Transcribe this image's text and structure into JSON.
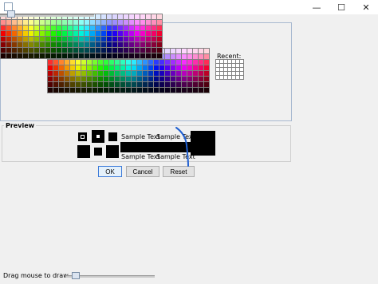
{
  "window": {
    "title": "",
    "minimize_glyph": "—",
    "maximize_glyph": "☐",
    "close_glyph": "✕"
  },
  "color_chooser": {
    "recent_label": "Recent:"
  },
  "preview": {
    "label": "Preview",
    "sample_text_1": "Sample Text",
    "sample_text_2": "Sample Text",
    "sample_text_3": "Sample Text",
    "sample_text_4": "Sample Text"
  },
  "buttons": {
    "ok": "OK",
    "cancel": "Cancel",
    "reset": "Reset"
  },
  "status": {
    "text": "Drag mouse to draw"
  },
  "colors": {
    "pen_stroke": "#1f5fd1"
  }
}
